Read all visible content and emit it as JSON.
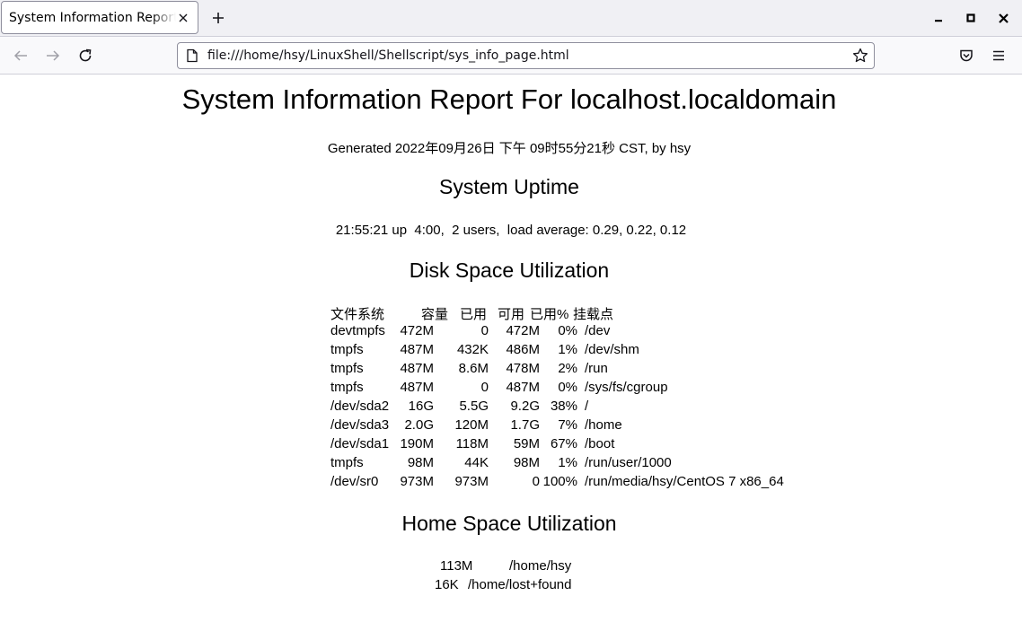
{
  "browser": {
    "tab_title": "System Information Report For localhost.localdomain",
    "url": "file:///home/hsy/LinuxShell/Shellscript/sys_info_page.html"
  },
  "page": {
    "title": "System Information Report For localhost.localdomain",
    "generated": "Generated 2022年09月26日 下午 09时55分21秒 CST, by hsy",
    "uptime_heading": "System Uptime",
    "uptime_text": "21:55:21 up  4:00,  2 users,  load average: 0.29, 0.22, 0.12",
    "disk_heading": "Disk Space Utilization",
    "disk_table": {
      "header": [
        "文件系统",
        "容量",
        "已用",
        "可用",
        "已用%",
        "挂载点"
      ],
      "rows": [
        [
          "devtmpfs",
          "472M",
          "0",
          "472M",
          "0%",
          "/dev"
        ],
        [
          "tmpfs",
          "487M",
          "432K",
          "486M",
          "1%",
          "/dev/shm"
        ],
        [
          "tmpfs",
          "487M",
          "8.6M",
          "478M",
          "2%",
          "/run"
        ],
        [
          "tmpfs",
          "487M",
          "0",
          "487M",
          "0%",
          "/sys/fs/cgroup"
        ],
        [
          "/dev/sda2",
          "16G",
          "5.5G",
          "9.2G",
          "38%",
          "/"
        ],
        [
          "/dev/sda3",
          "2.0G",
          "120M",
          "1.7G",
          "7%",
          "/home"
        ],
        [
          "/dev/sda1",
          "190M",
          "118M",
          "59M",
          "67%",
          "/boot"
        ],
        [
          "tmpfs",
          "98M",
          "44K",
          "98M",
          "1%",
          "/run/user/1000"
        ],
        [
          "/dev/sr0",
          "973M",
          "973M",
          "0",
          "100%",
          "/run/media/hsy/CentOS 7 x86_64"
        ]
      ]
    },
    "home_heading": "Home Space Utilization",
    "home_table": {
      "rows": [
        [
          "113M",
          "/home/hsy"
        ],
        [
          "16K",
          "/home/lost+found"
        ]
      ]
    }
  }
}
